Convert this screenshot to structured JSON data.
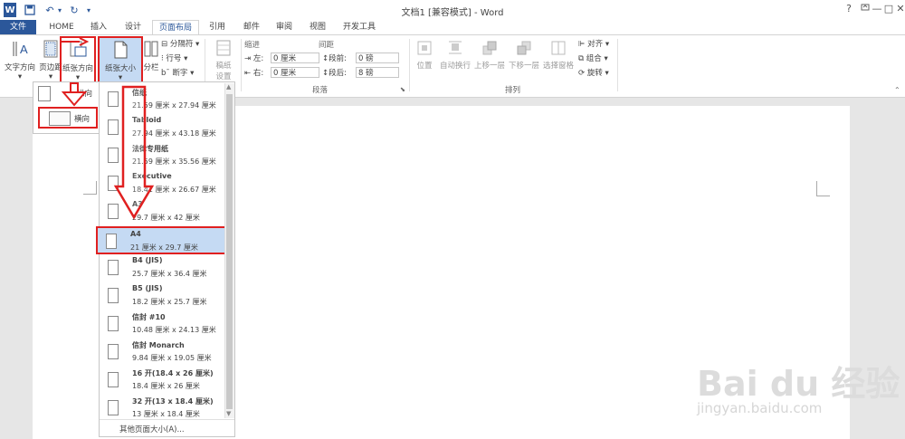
{
  "window": {
    "title": "文档1 [兼容模式] - Word",
    "help": "?",
    "buttons": [
      "—",
      "□",
      "✕"
    ]
  },
  "qat": {
    "word_icon": "W",
    "save_icon": "save-icon",
    "undo_icon": "↶",
    "redo_icon": "↻"
  },
  "tabs": [
    "文件",
    "HOME",
    "插入",
    "设计",
    "页面布局",
    "引用",
    "邮件",
    "审阅",
    "视图",
    "开发工具"
  ],
  "ribbon": {
    "page_setup": {
      "text_direction": "文字方向",
      "margins": "页边距",
      "orientation": "纸张方向",
      "size": "纸张大小",
      "columns": "分栏",
      "breaks": "分隔符",
      "line_numbers": "行号",
      "hyphenation": "断字"
    },
    "draft": {
      "label_1": "稿纸",
      "label_2": "设置"
    },
    "indent": {
      "header": "缩进",
      "left_label": "左:",
      "left_value": "0 厘米",
      "right_label": "右:",
      "right_value": "0 厘米"
    },
    "spacing": {
      "header": "间距",
      "before_label": "段前:",
      "before_value": "0 磅",
      "after_label": "段后:",
      "after_value": "8 磅"
    },
    "paragraph_group": "段落",
    "arrange": {
      "position": "位置",
      "wrap": "自动换行",
      "forward": "上移一层",
      "backward": "下移一层",
      "selection_pane": "选择窗格",
      "align": "对齐",
      "group": "组合",
      "rotate": "旋转",
      "group_label": "排列"
    }
  },
  "orientation_menu": {
    "portrait": "纵向",
    "landscape": "横向"
  },
  "size_menu": {
    "items": [
      {
        "name": "信纸",
        "dims": "21.59 厘米 x 27.94 厘米"
      },
      {
        "name": "Tabloid",
        "dims": "27.94 厘米 x 43.18 厘米"
      },
      {
        "name": "法律专用纸",
        "dims": "21.59 厘米 x 35.56 厘米"
      },
      {
        "name": "Executive",
        "dims": "18.41 厘米 x 26.67 厘米"
      },
      {
        "name": "A3",
        "dims": "29.7 厘米 x 42 厘米"
      },
      {
        "name": "A4",
        "dims": "21 厘米 x 29.7 厘米"
      },
      {
        "name": "B4 (JIS)",
        "dims": "25.7 厘米 x 36.4 厘米"
      },
      {
        "name": "B5 (JIS)",
        "dims": "18.2 厘米 x 25.7 厘米"
      },
      {
        "name": "信封 #10",
        "dims": "10.48 厘米 x 24.13 厘米"
      },
      {
        "name": "信封 Monarch",
        "dims": "9.84 厘米 x 19.05 厘米"
      },
      {
        "name": "16 开(18.4 x 26 厘米)",
        "dims": "18.4 厘米 x 26 厘米"
      },
      {
        "name": "32 开(13 x 18.4 厘米)",
        "dims": "13 厘米 x 18.4 厘米"
      }
    ],
    "more": "其他页面大小(A)..."
  },
  "watermark": {
    "brand": "Bai du 经验",
    "url": "jingyan.baidu.com"
  },
  "colors": {
    "accent": "#2b579a",
    "annotation": "#e02020",
    "highlight": "#c5daf3"
  }
}
